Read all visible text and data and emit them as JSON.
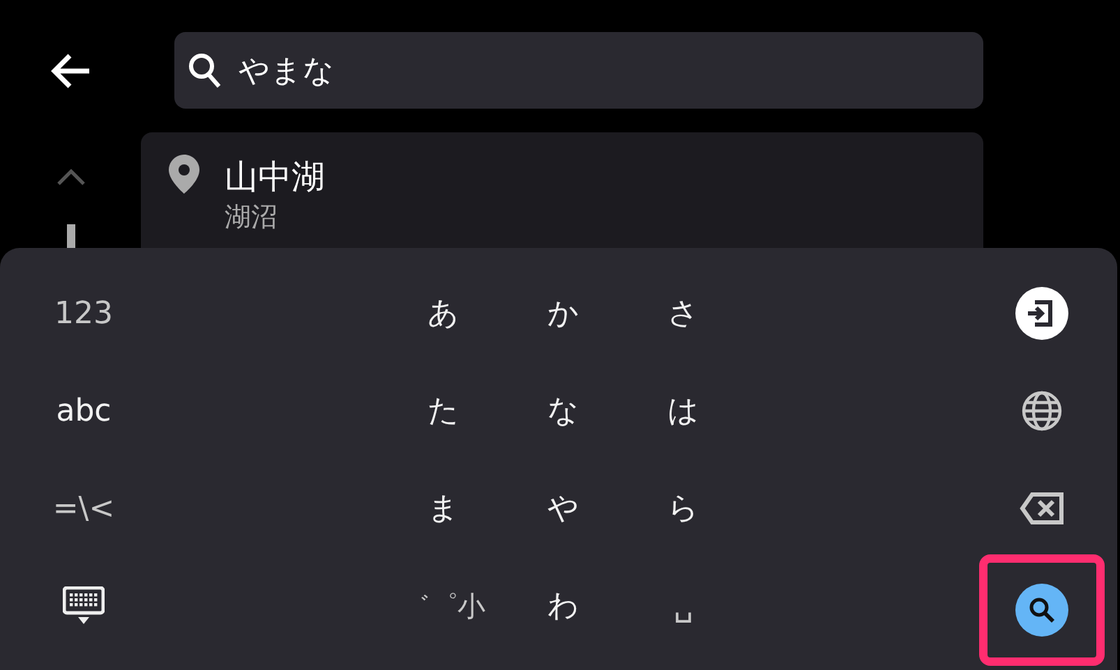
{
  "search": {
    "value": "やまな"
  },
  "results": [
    {
      "title": "山中湖",
      "subtitle": "湖沼"
    }
  ],
  "keyboard": {
    "mode_keys": [
      {
        "label": "123"
      },
      {
        "label": "abc"
      },
      {
        "label": "=\\<"
      }
    ],
    "kana_rows": [
      [
        "あ",
        "か",
        "さ"
      ],
      [
        "た",
        "な",
        "は"
      ],
      [
        "ま",
        "や",
        "ら"
      ],
      [
        "゛゜小",
        "わ",
        "␣"
      ]
    ],
    "search_key": {
      "highlighted": true
    }
  }
}
